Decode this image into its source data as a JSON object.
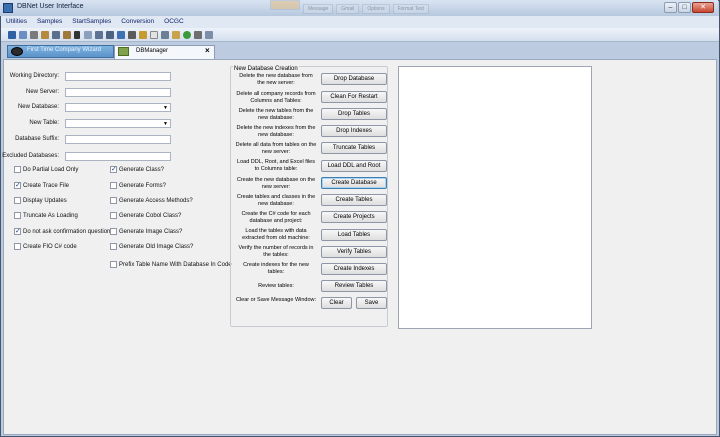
{
  "window": {
    "title": "DBNet User Interface"
  },
  "bg_tabs": [
    "",
    "Message",
    "Gmail",
    "Options",
    "Format Text",
    ""
  ],
  "menu": [
    "Utilities",
    "Samples",
    "StartSamples",
    "Conversion",
    "OCGC"
  ],
  "doc_tabs": {
    "first": "First Time Company Wizard",
    "active": "DBManager"
  },
  "form": {
    "working_directory": {
      "label": "Working Directory:",
      "value": ""
    },
    "new_server": {
      "label": "New Server:",
      "value": ""
    },
    "new_database": {
      "label": "New Database:",
      "value": ""
    },
    "new_table": {
      "label": "New Table:",
      "value": ""
    },
    "database_suffix": {
      "label": "Database Suffix:",
      "value": ""
    },
    "excluded_databases": {
      "label": "Excluded Databases:",
      "value": ""
    }
  },
  "checkboxes_left": [
    {
      "label": "Do Partial Load Only",
      "checked": false
    },
    {
      "label": "Create Trace File",
      "checked": true
    },
    {
      "label": "Display Updates",
      "checked": false
    },
    {
      "label": "Truncate As Loading",
      "checked": false
    },
    {
      "label": "Do not ask confirmation questions",
      "checked": true
    },
    {
      "label": "Create FIO C# code",
      "checked": false
    }
  ],
  "checkboxes_right": [
    {
      "label": "Generate Class?",
      "checked": true
    },
    {
      "label": "Generate Forms?",
      "checked": false
    },
    {
      "label": "Generate Access Methods?",
      "checked": false
    },
    {
      "label": "Generate Cobol Class?",
      "checked": false
    },
    {
      "label": "Generate Image Class?",
      "checked": false
    },
    {
      "label": "Generate Old Image Class?",
      "checked": false
    },
    {
      "label": "Prefix Table Name With Database In Code",
      "checked": false
    }
  ],
  "group": {
    "title": "New Database Creation",
    "rows": [
      {
        "desc": "Delete the new database from the new server:",
        "button": "Drop Database"
      },
      {
        "desc": "Delete all company records from Columns and Tables:",
        "button": "Clean For Restart"
      },
      {
        "desc": "Delete the new tables from the new database:",
        "button": "Drop Tables"
      },
      {
        "desc": "Delete the new indexes from the new database:",
        "button": "Drop Indexes"
      },
      {
        "desc": "Delete all data from tables on the new server:",
        "button": "Truncate Tables"
      },
      {
        "desc": "Load DDL, Root, and Excel files to Columns table:",
        "button": "Load DDL and Root"
      },
      {
        "desc": "Create the new database on the new server:",
        "button": "Create Database"
      },
      {
        "desc": "Create tables and classes in the new database:",
        "button": "Create Tables"
      },
      {
        "desc": "Create the C# code for each database and project:",
        "button": "Create Projects"
      },
      {
        "desc": "Load the tables with data extracted from old machine:",
        "button": "Load Tables"
      },
      {
        "desc": "Verify the number of records in the tables:",
        "button": "Verify Tables"
      },
      {
        "desc": "Create indexes for the new tables:",
        "button": "Create Indexes"
      },
      {
        "desc": "Review tables:",
        "button": "Review Tables"
      }
    ],
    "message": {
      "desc": "Clear or Save Message Window:",
      "clear": "Clear",
      "save": "Save"
    }
  },
  "colors": {
    "title_gradient": "#b7c8de",
    "active_tab": "#5b93c9",
    "focus_border": "#3c7fb1"
  }
}
